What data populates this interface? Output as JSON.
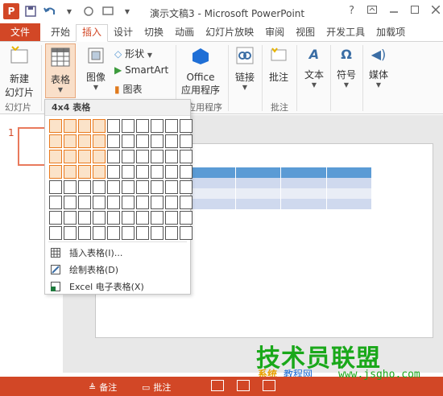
{
  "window": {
    "title": "演示文稿3 - Microsoft PowerPoint",
    "help": "?",
    "logo_letter": "P"
  },
  "tabs": [
    {
      "label": "文件"
    },
    {
      "label": "开始"
    },
    {
      "label": "插入"
    },
    {
      "label": "设计"
    },
    {
      "label": "切换"
    },
    {
      "label": "动画"
    },
    {
      "label": "幻灯片放映"
    },
    {
      "label": "审阅"
    },
    {
      "label": "视图"
    },
    {
      "label": "开发工具"
    },
    {
      "label": "加载项"
    }
  ],
  "ribbon": {
    "new_slide_line1": "新建",
    "new_slide_line2": "幻灯片",
    "slides_group": "幻灯片",
    "table_label": "表格",
    "image_label": "图像",
    "shapes_label": "形状",
    "smartart_label": "SmartArt",
    "chart_label": "图表",
    "office_line1": "Office",
    "office_line2": "应用程序",
    "apps_group": "应用程序",
    "link_label": "链接",
    "comment_label": "批注",
    "comment_group": "批注",
    "text_label": "文本",
    "symbol_label": "符号",
    "media_label": "媒体"
  },
  "thumbnail": {
    "number": "1"
  },
  "dropdown": {
    "header": "4x4 表格",
    "grid_cols": 10,
    "grid_rows": 8,
    "selected_cols": 4,
    "selected_rows": 4,
    "items": [
      {
        "label": "插入表格(I)..."
      },
      {
        "label": "绘制表格(D)"
      },
      {
        "label": "Excel 电子表格(X)"
      }
    ]
  },
  "status": {
    "notes": "备注",
    "comments": "批注"
  },
  "watermark": {
    "main": "技术员联盟",
    "sub1": "系统",
    "sub2": "教程网",
    "url": "www.jsgho.com"
  },
  "colors": {
    "accent": "#d24726",
    "selection": "#e97a1e",
    "table_header": "#5b9bd5"
  }
}
